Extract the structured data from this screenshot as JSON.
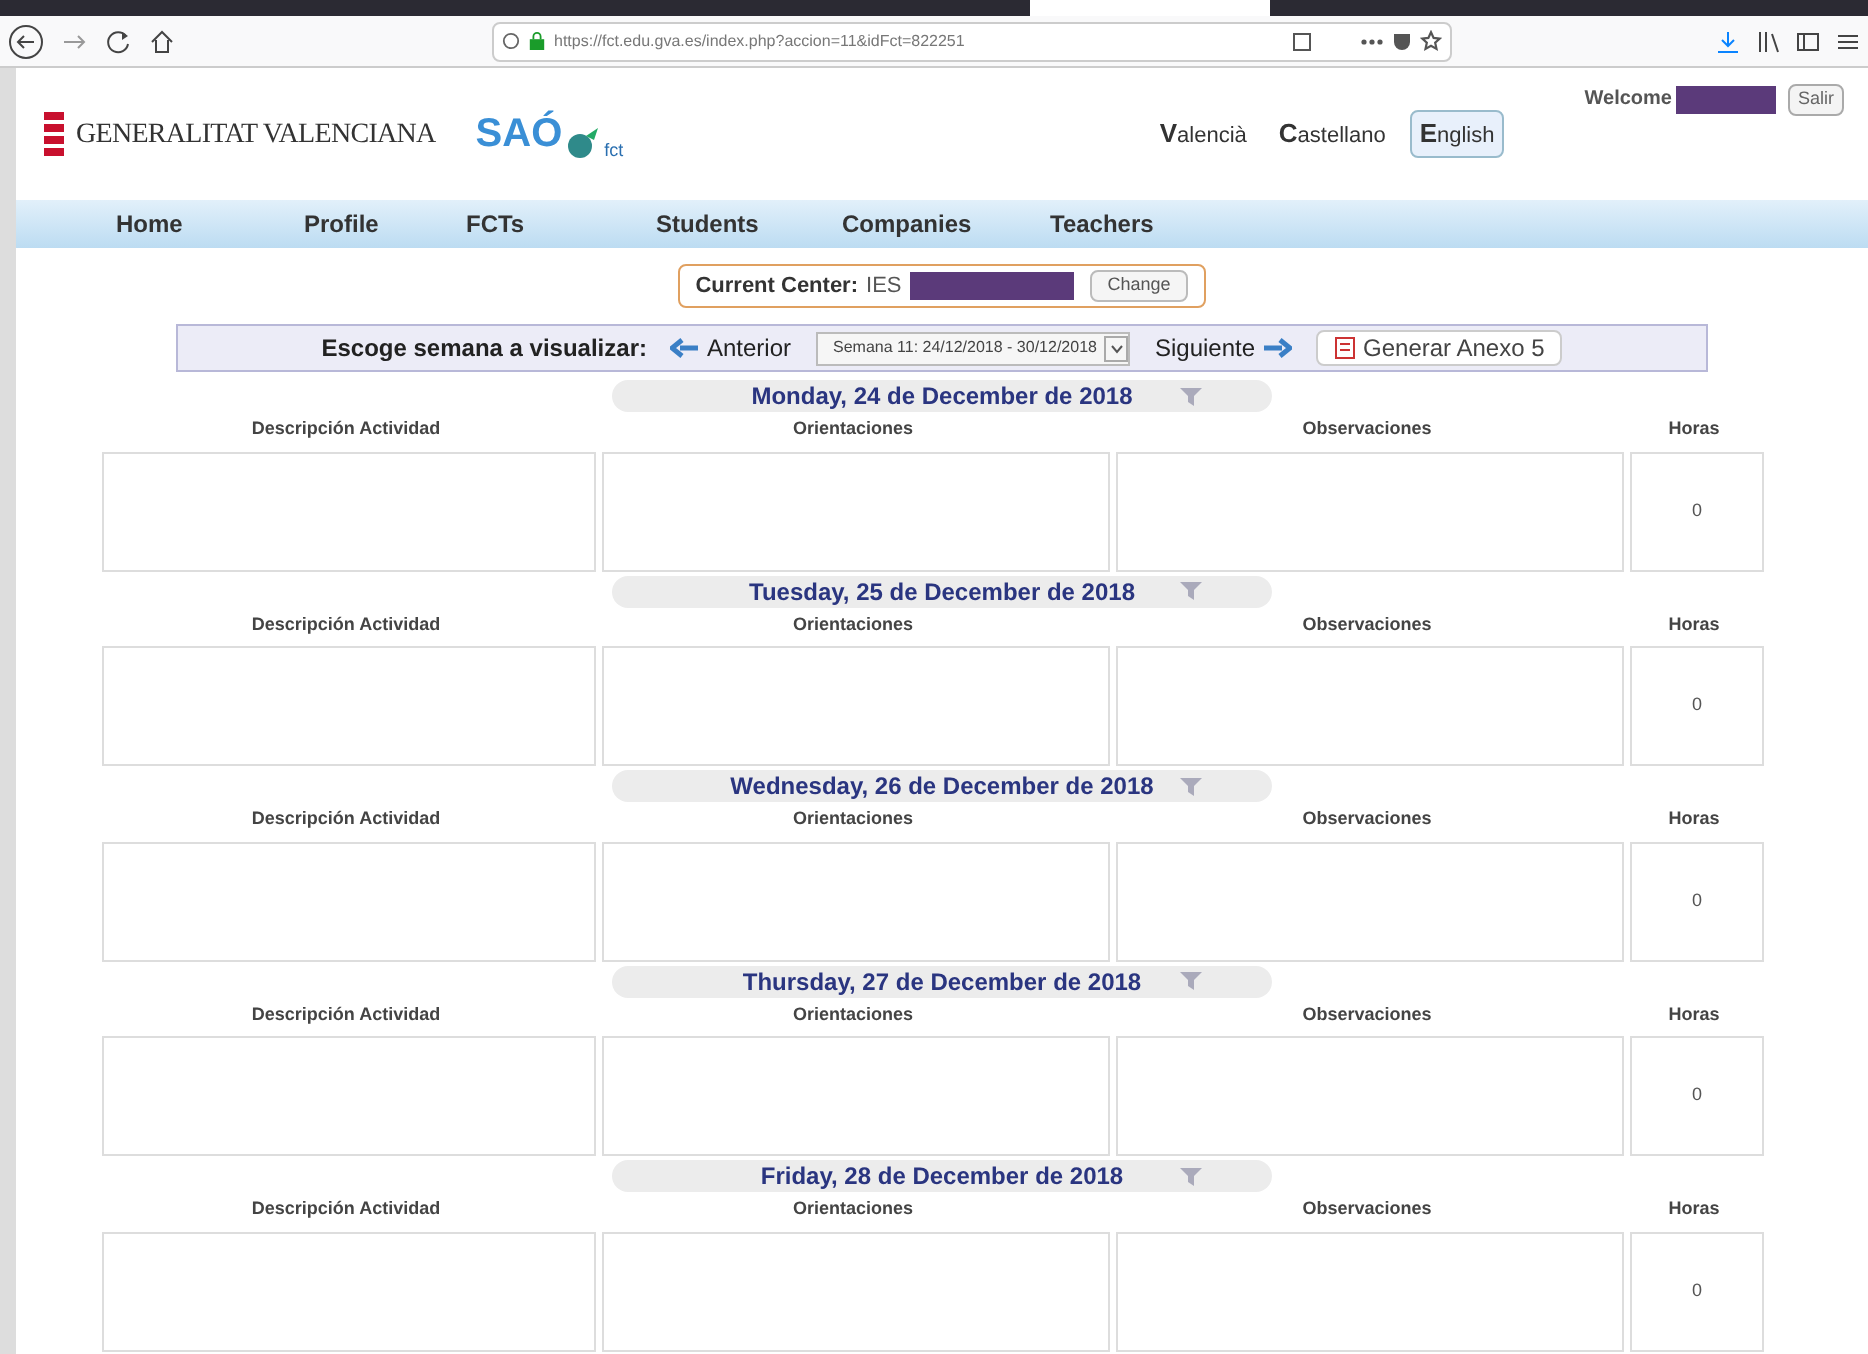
{
  "browser": {
    "url": "https://fct.edu.gva.es/index.php?accion=11&idFct=822251"
  },
  "header": {
    "logo_text": "GENERALITAT VALENCIANA",
    "app_logo": "SAÓ",
    "app_sub": "fct",
    "languages": [
      {
        "initial": "V",
        "rest": "alencià",
        "selected": false
      },
      {
        "initial": "C",
        "rest": "astellano",
        "selected": false
      },
      {
        "initial": "E",
        "rest": "nglish",
        "selected": true
      }
    ],
    "welcome": "Welcome",
    "logout": "Salir"
  },
  "nav": [
    "Home",
    "Profile",
    "FCTs",
    "Students",
    "Companies",
    "Teachers"
  ],
  "center": {
    "label": "Current Center:",
    "value": "IES",
    "button": "Change"
  },
  "week_bar": {
    "label": "Escoge semana a visualizar:",
    "prev": "Anterior",
    "week": "Semana 11: 24/12/2018 - 30/12/2018",
    "next": "Siguiente",
    "report": "Generar Anexo 5"
  },
  "days": [
    {
      "title": "Monday, 24 de December de 2018",
      "columns": [
        "Descripción Actividad",
        "Orientaciones",
        "Observaciones",
        "Horas"
      ],
      "hours": "0"
    },
    {
      "title": "Tuesday, 25 de December de 2018",
      "columns": [
        "Descripción Actividad",
        "Orientaciones",
        "Observaciones",
        "Horas"
      ],
      "hours": "0"
    },
    {
      "title": "Wednesday, 26 de December de 2018",
      "columns": [
        "Descripción Actividad",
        "Orientaciones",
        "Observaciones",
        "Horas"
      ],
      "hours": "0"
    },
    {
      "title": "Thursday, 27 de December de 2018",
      "columns": [
        "Descripción Actividad",
        "Orientaciones",
        "Observaciones",
        "Horas"
      ],
      "hours": "0"
    },
    {
      "title": "Friday, 28 de December de 2018",
      "columns": [
        "Descripción Actividad",
        "Orientaciones",
        "Observaciones",
        "Horas"
      ],
      "hours": "0"
    }
  ]
}
